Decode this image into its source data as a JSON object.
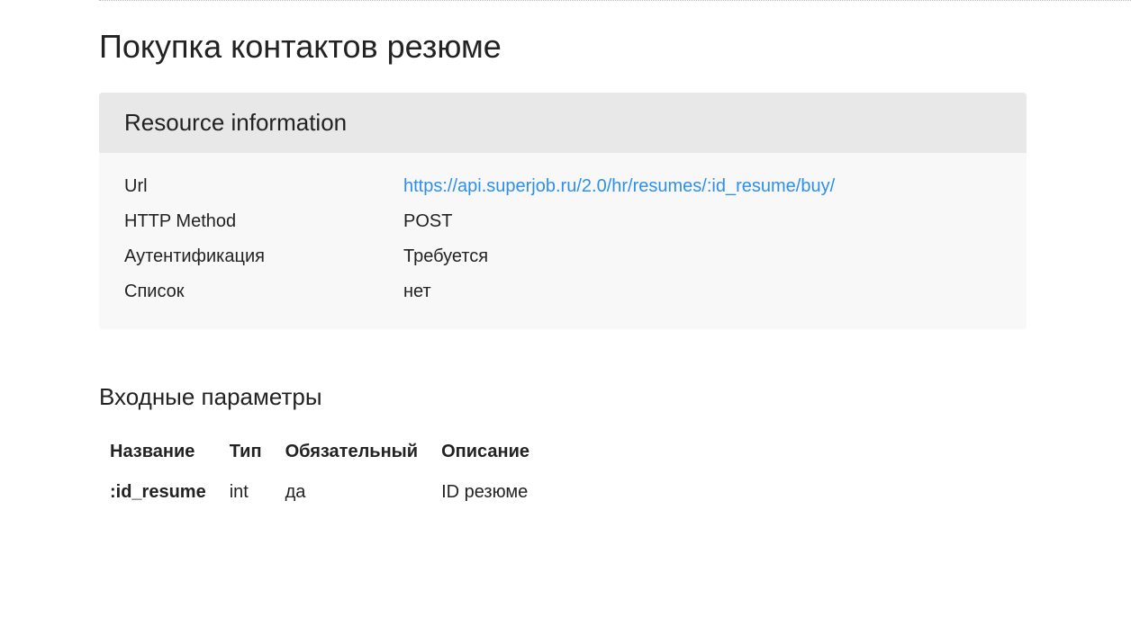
{
  "page_title": "Покупка контактов резюме",
  "resource_info": {
    "header": "Resource information",
    "rows": {
      "url_label": "Url",
      "url_value": "https://api.superjob.ru/2.0/hr/resumes/:id_resume/buy/",
      "http_method_label": "HTTP Method",
      "http_method_value": "POST",
      "auth_label": "Аутентификация",
      "auth_value": "Требуется",
      "list_label": "Список",
      "list_value": "нет"
    }
  },
  "input_params": {
    "title": "Входные параметры",
    "headers": {
      "name": "Название",
      "type": "Тип",
      "required": "Обязательный",
      "description": "Описание"
    },
    "rows": [
      {
        "name": ":id_resume",
        "type": "int",
        "required": "да",
        "description": "ID резюме"
      }
    ]
  }
}
